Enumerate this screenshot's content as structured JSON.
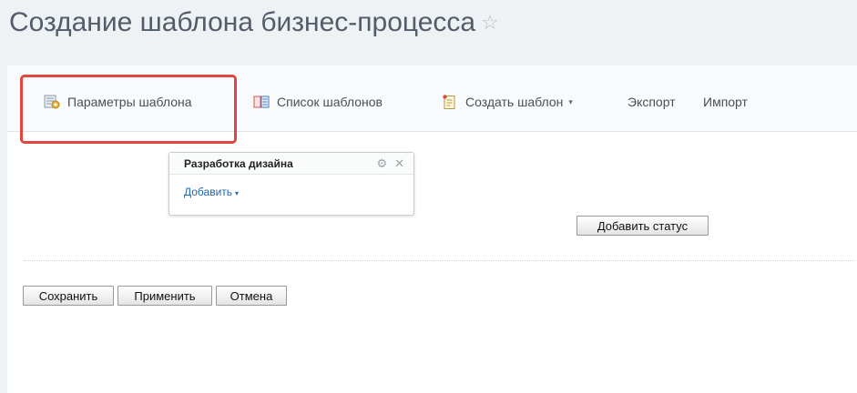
{
  "page": {
    "title": "Создание шаблона бизнес-процесса",
    "star": "☆"
  },
  "toolbar": {
    "template_params": "Параметры шаблона",
    "template_list": "Список шаблонов",
    "create_template": "Создать шаблон",
    "create_caret": "▾",
    "export": "Экспорт",
    "import": "Импорт"
  },
  "status_box": {
    "title": "Разработка дизайна",
    "gear_icon": "⚙",
    "close_icon": "✕",
    "add_label": "Добавить",
    "add_caret": "▾"
  },
  "actions": {
    "add_status": "Добавить статус",
    "save": "Сохранить",
    "apply": "Применить",
    "cancel": "Отмена"
  },
  "colors": {
    "highlight": "#e0463f",
    "link": "#2067b0",
    "title": "#535c69"
  }
}
